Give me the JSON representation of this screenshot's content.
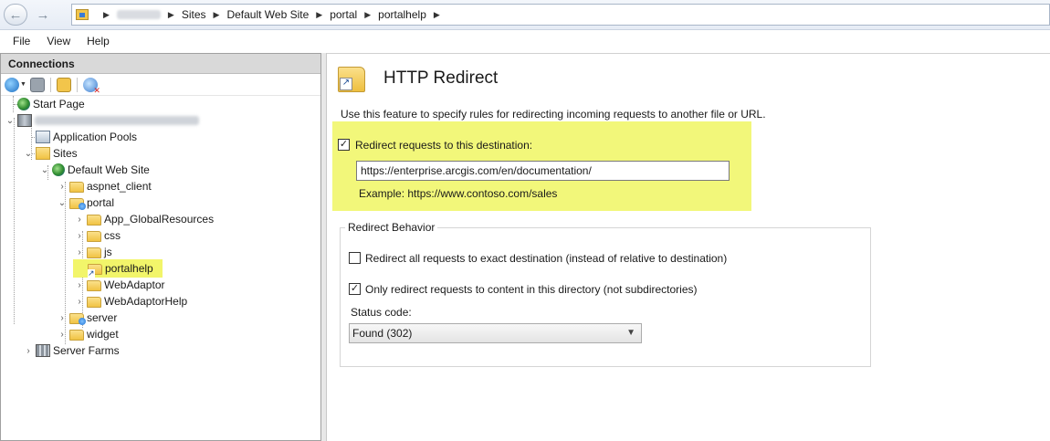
{
  "address_bar": {
    "back_icon": "arrow-left-icon",
    "forward_icon": "arrow-right-icon",
    "breadcrumbs": [
      "Sites",
      "Default Web Site",
      "portal",
      "portalhelp"
    ]
  },
  "menu": [
    "File",
    "View",
    "Help"
  ],
  "connections": {
    "header": "Connections",
    "toolbar": [
      "connect-icon",
      "save-icon",
      "up-folder-icon",
      "disconnect-icon"
    ],
    "tree": {
      "start_page": "Start Page",
      "application_pools": "Application Pools",
      "sites": "Sites",
      "default_web_site": "Default Web Site",
      "aspnet_client": "aspnet_client",
      "portal": "portal",
      "app_globalresources": "App_GlobalResources",
      "css": "css",
      "js": "js",
      "portalhelp": "portalhelp",
      "webadaptor": "WebAdaptor",
      "webadaptorhelp": "WebAdaptorHelp",
      "server": "server",
      "widget": "widget",
      "server_farms": "Server Farms"
    },
    "selected": "portalhelp"
  },
  "feature": {
    "title": "HTTP Redirect",
    "description": "Use this feature to specify rules for redirecting incoming requests to another file or URL.",
    "redirect_enabled_label": "Redirect requests to this destination:",
    "redirect_enabled": true,
    "destination": "https://enterprise.arcgis.com/en/documentation/",
    "example": "Example: https://www.contoso.com/sales",
    "highlight_color": "#f2f77a",
    "behavior": {
      "legend": "Redirect Behavior",
      "exact_label": "Redirect all requests to exact destination (instead of relative to destination)",
      "exact_checked": false,
      "only_dir_label": "Only redirect requests to content in this directory (not subdirectories)",
      "only_dir_checked": true,
      "status_label": "Status code:",
      "status_value": "Found (302)"
    }
  }
}
